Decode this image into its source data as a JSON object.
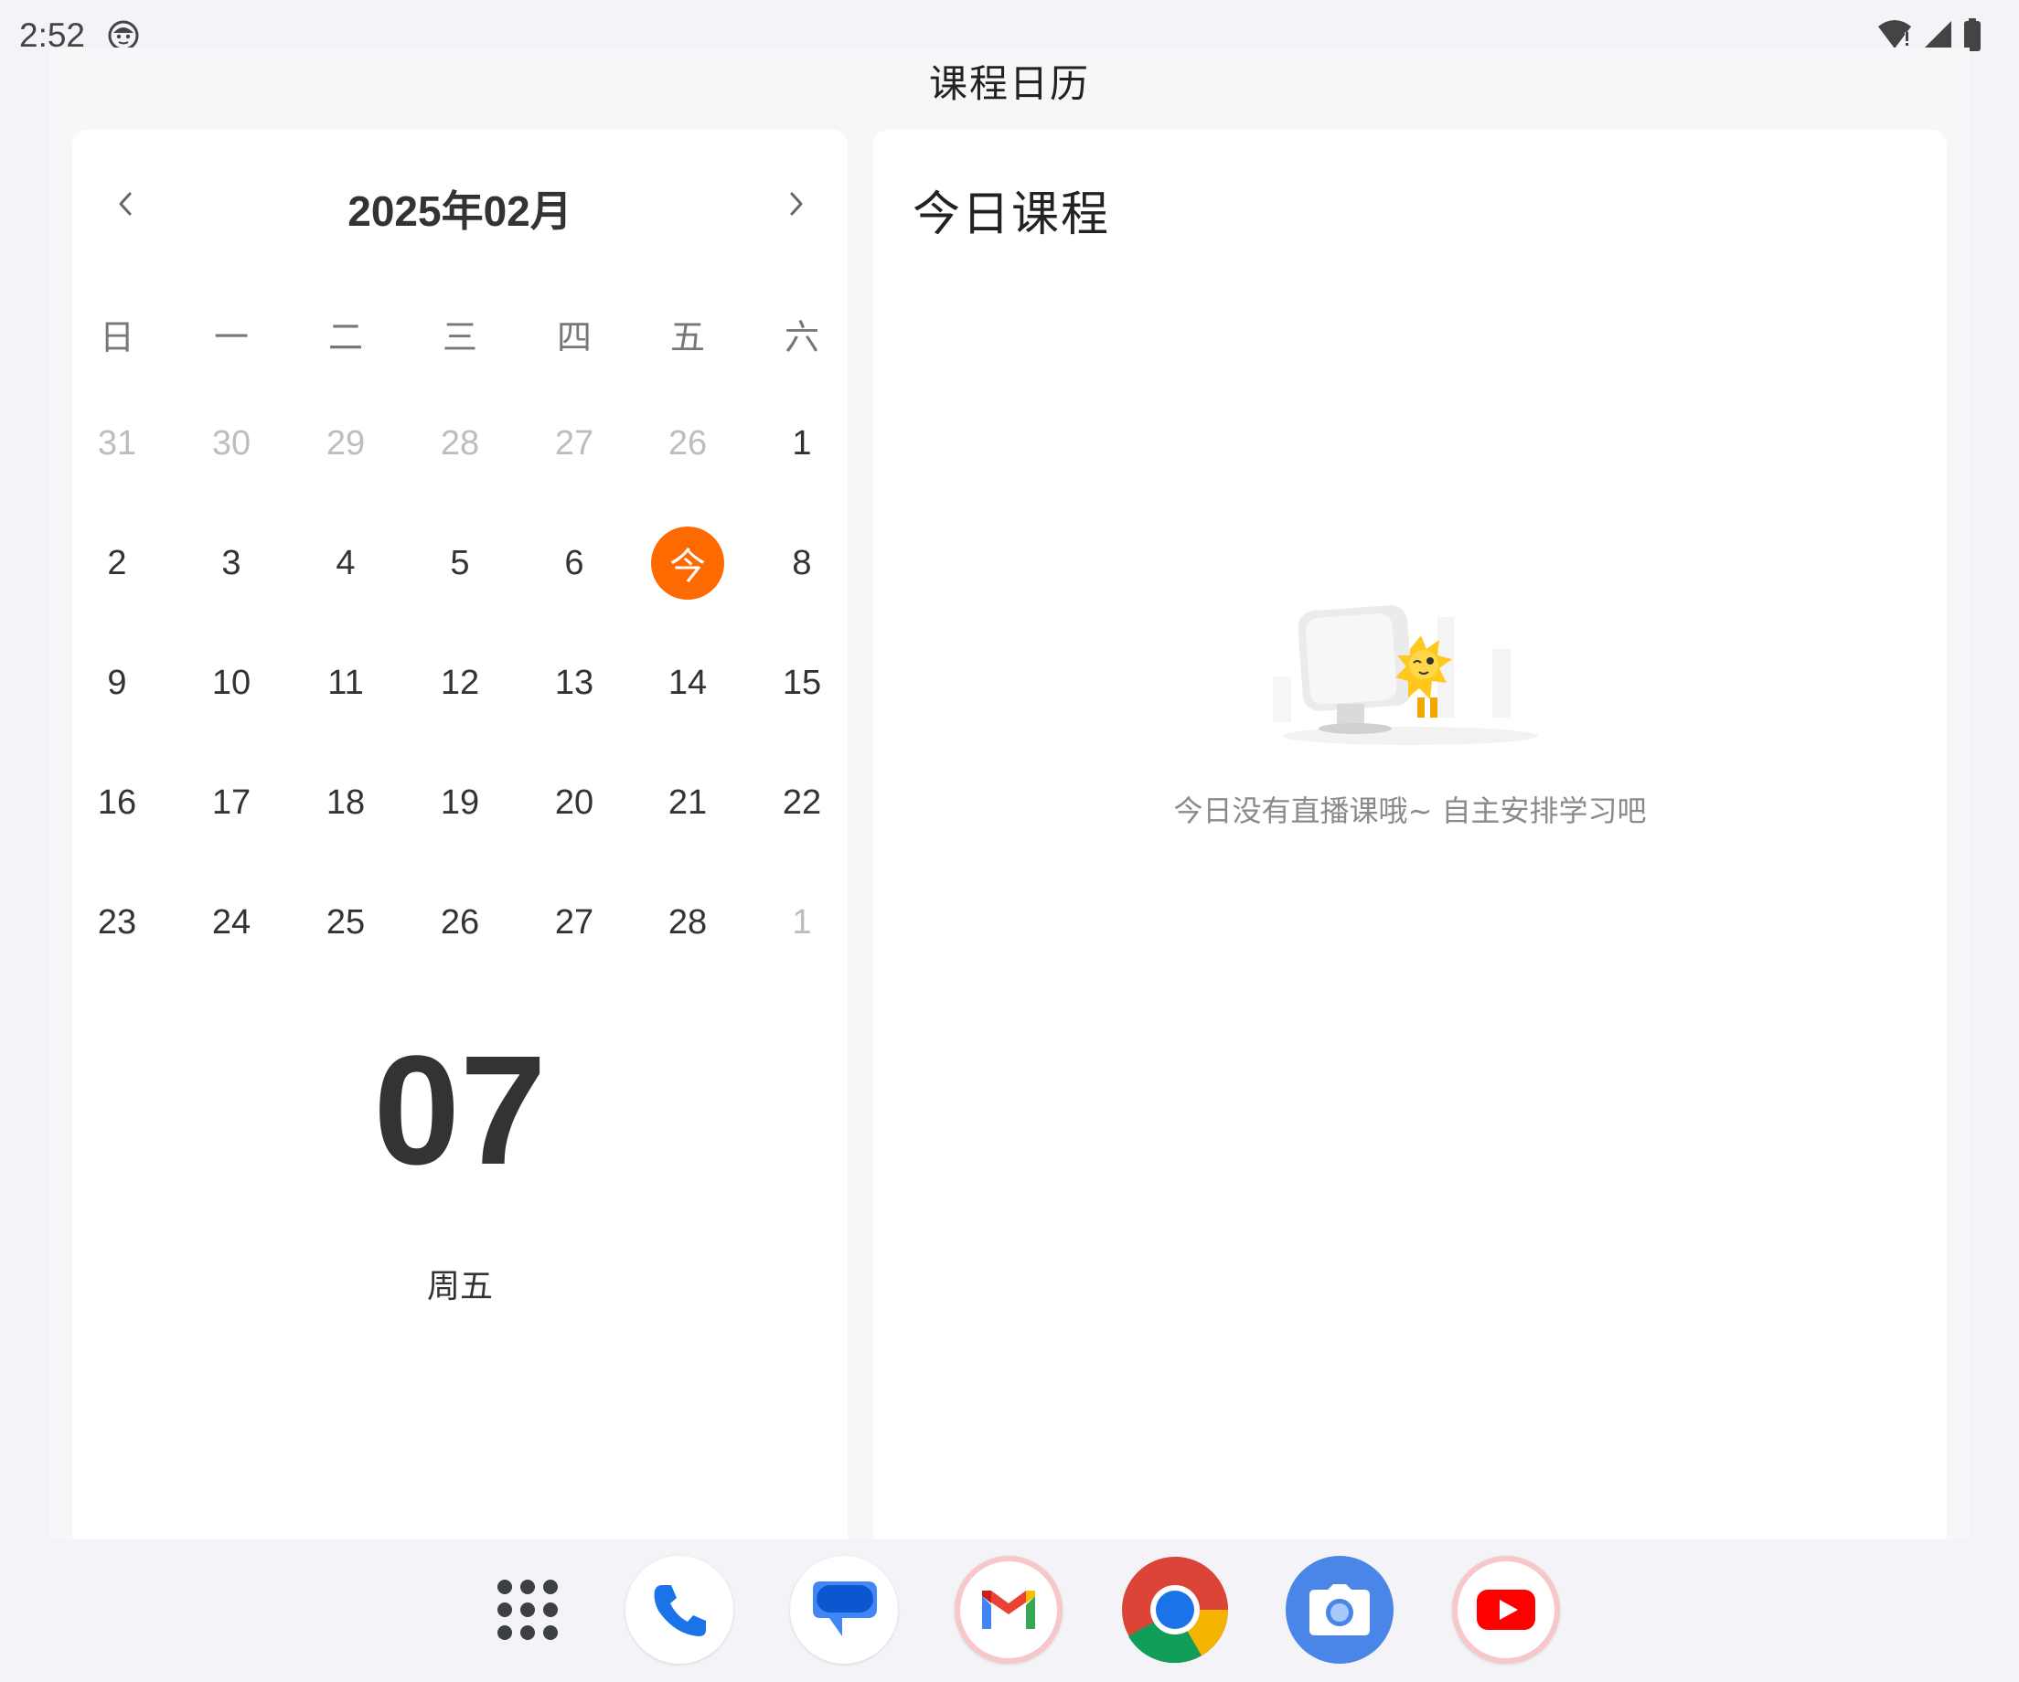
{
  "status_bar": {
    "time": "2:52",
    "icons": [
      "face-icon",
      "wifi-icon",
      "signal-icon",
      "battery-icon"
    ]
  },
  "app": {
    "title": "课程日历"
  },
  "calendar": {
    "month_title": "2025年02月",
    "prev_icon": "chevron-left-icon",
    "next_icon": "chevron-right-icon",
    "weekdays": [
      "日",
      "一",
      "二",
      "三",
      "四",
      "五",
      "六"
    ],
    "weeks": [
      [
        {
          "d": "31",
          "muted": true
        },
        {
          "d": "30",
          "muted": true
        },
        {
          "d": "29",
          "muted": true
        },
        {
          "d": "28",
          "muted": true
        },
        {
          "d": "27",
          "muted": true
        },
        {
          "d": "26",
          "muted": true
        },
        {
          "d": "1",
          "muted": false
        }
      ],
      [
        {
          "d": "2",
          "muted": false
        },
        {
          "d": "3",
          "muted": false
        },
        {
          "d": "4",
          "muted": false
        },
        {
          "d": "5",
          "muted": false
        },
        {
          "d": "6",
          "muted": false
        },
        {
          "d": "今",
          "muted": false,
          "today": true
        },
        {
          "d": "8",
          "muted": false
        }
      ],
      [
        {
          "d": "9",
          "muted": false
        },
        {
          "d": "10",
          "muted": false
        },
        {
          "d": "11",
          "muted": false
        },
        {
          "d": "12",
          "muted": false
        },
        {
          "d": "13",
          "muted": false
        },
        {
          "d": "14",
          "muted": false
        },
        {
          "d": "15",
          "muted": false
        }
      ],
      [
        {
          "d": "16",
          "muted": false
        },
        {
          "d": "17",
          "muted": false
        },
        {
          "d": "18",
          "muted": false
        },
        {
          "d": "19",
          "muted": false
        },
        {
          "d": "20",
          "muted": false
        },
        {
          "d": "21",
          "muted": false
        },
        {
          "d": "22",
          "muted": false
        }
      ],
      [
        {
          "d": "23",
          "muted": false
        },
        {
          "d": "24",
          "muted": false
        },
        {
          "d": "25",
          "muted": false
        },
        {
          "d": "26",
          "muted": false
        },
        {
          "d": "27",
          "muted": false
        },
        {
          "d": "28",
          "muted": false
        },
        {
          "d": "1",
          "muted": true
        }
      ]
    ],
    "today_color": "#FF6A00",
    "selected_day": "07",
    "selected_weekday": "周五"
  },
  "courses": {
    "title": "今日课程",
    "empty_text": "今日没有直播课哦~ 自主安排学习吧",
    "empty_icon": "empty-state-illustration"
  },
  "dock": {
    "items": [
      {
        "name": "app-drawer",
        "icon": "apps-grid-icon"
      },
      {
        "name": "phone",
        "icon": "phone-icon"
      },
      {
        "name": "messages",
        "icon": "messages-icon"
      },
      {
        "name": "gmail",
        "icon": "gmail-icon"
      },
      {
        "name": "chrome",
        "icon": "chrome-icon"
      },
      {
        "name": "camera",
        "icon": "camera-icon"
      },
      {
        "name": "youtube",
        "icon": "youtube-icon"
      }
    ]
  }
}
